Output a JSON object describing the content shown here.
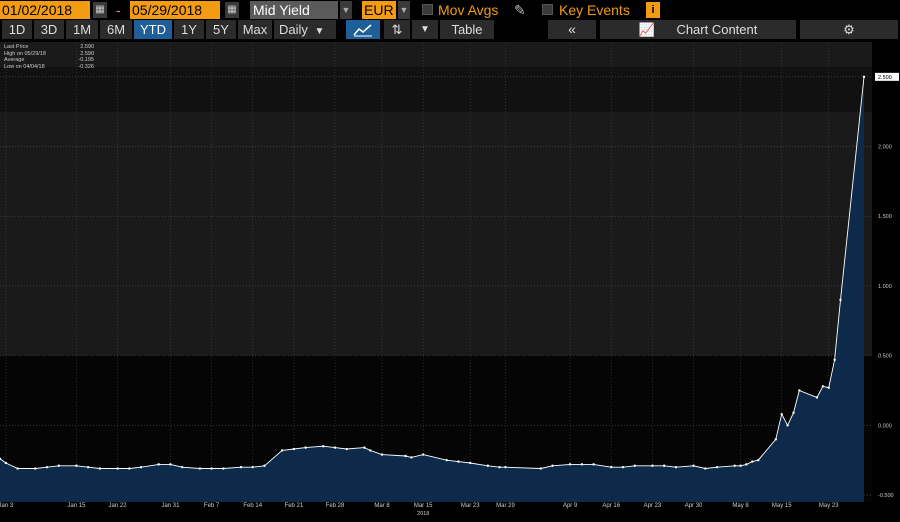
{
  "toolbar": {
    "start_date": "01/02/2018",
    "end_date": "05/29/2018",
    "date_separator": "-",
    "field": "Mid Yield",
    "currency": "EUR",
    "mov_avgs_label": "Mov Avgs",
    "key_events_label": "Key Events",
    "info_glyph": "i",
    "calendar_icon": "calendar-icon",
    "pencil_icon": "pencil-icon"
  },
  "ranges": [
    "1D",
    "3D",
    "1M",
    "6M",
    "YTD",
    "1Y",
    "5Y",
    "Max"
  ],
  "active_range": "YTD",
  "frequency": "Daily",
  "table_label": "Table",
  "chart_content_label": "Chart Content",
  "colors": {
    "accent": "#f39c12",
    "active": "#1f5f99",
    "area": "#0d2a4a",
    "line": "#ffffff"
  },
  "legend": [
    {
      "label": "Last Price",
      "value": "2.590"
    },
    {
      "label": "High on 05/29/18",
      "value": "2.590"
    },
    {
      "label": "Average",
      "value": "-0.195"
    },
    {
      "label": "Low on 04/04/18",
      "value": "-0.326"
    }
  ],
  "chart_data": {
    "type": "area",
    "title": "",
    "xlabel": "",
    "ylabel": "",
    "year_label": "2018",
    "last_value_label": "2.500",
    "ylim": [
      -0.55,
      2.75
    ],
    "y_ticks": [
      2.5,
      2.0,
      1.5,
      1.0,
      0.5,
      0.0,
      -0.5
    ],
    "y_tick_labels": [
      "2.500",
      "2.000",
      "1.500",
      "1.000",
      "0.500",
      "0.000",
      "-0.500"
    ],
    "x_ticks": [
      {
        "label": "Jan 3",
        "date": "2018-01-03"
      },
      {
        "label": "Jan 15",
        "date": "2018-01-15"
      },
      {
        "label": "Jan 22",
        "date": "2018-01-22"
      },
      {
        "label": "Jan 31",
        "date": "2018-01-31"
      },
      {
        "label": "Feb 7",
        "date": "2018-02-07"
      },
      {
        "label": "Feb 14",
        "date": "2018-02-14"
      },
      {
        "label": "Feb 21",
        "date": "2018-02-21"
      },
      {
        "label": "Feb 28",
        "date": "2018-02-28"
      },
      {
        "label": "Mar 8",
        "date": "2018-03-08"
      },
      {
        "label": "Mar 15",
        "date": "2018-03-15"
      },
      {
        "label": "Mar 23",
        "date": "2018-03-23"
      },
      {
        "label": "Mar 29",
        "date": "2018-03-29"
      },
      {
        "label": "Apr 9",
        "date": "2018-04-09"
      },
      {
        "label": "Apr 16",
        "date": "2018-04-16"
      },
      {
        "label": "Apr 23",
        "date": "2018-04-23"
      },
      {
        "label": "Apr 30",
        "date": "2018-04-30"
      },
      {
        "label": "May 8",
        "date": "2018-05-08"
      },
      {
        "label": "May 15",
        "date": "2018-05-15"
      },
      {
        "label": "May 23",
        "date": "2018-05-23"
      }
    ],
    "series": [
      {
        "points": [
          [
            "2018-01-02",
            -0.24
          ],
          [
            "2018-01-03",
            -0.27
          ],
          [
            "2018-01-05",
            -0.31
          ],
          [
            "2018-01-08",
            -0.31
          ],
          [
            "2018-01-10",
            -0.3
          ],
          [
            "2018-01-12",
            -0.29
          ],
          [
            "2018-01-15",
            -0.29
          ],
          [
            "2018-01-17",
            -0.3
          ],
          [
            "2018-01-19",
            -0.31
          ],
          [
            "2018-01-22",
            -0.31
          ],
          [
            "2018-01-24",
            -0.31
          ],
          [
            "2018-01-26",
            -0.3
          ],
          [
            "2018-01-29",
            -0.28
          ],
          [
            "2018-01-31",
            -0.28
          ],
          [
            "2018-02-02",
            -0.3
          ],
          [
            "2018-02-05",
            -0.31
          ],
          [
            "2018-02-07",
            -0.31
          ],
          [
            "2018-02-09",
            -0.31
          ],
          [
            "2018-02-12",
            -0.3
          ],
          [
            "2018-02-14",
            -0.3
          ],
          [
            "2018-02-16",
            -0.29
          ],
          [
            "2018-02-19",
            -0.18
          ],
          [
            "2018-02-21",
            -0.17
          ],
          [
            "2018-02-23",
            -0.16
          ],
          [
            "2018-02-26",
            -0.15
          ],
          [
            "2018-02-28",
            -0.16
          ],
          [
            "2018-03-02",
            -0.17
          ],
          [
            "2018-03-05",
            -0.16
          ],
          [
            "2018-03-06",
            -0.18
          ],
          [
            "2018-03-08",
            -0.21
          ],
          [
            "2018-03-12",
            -0.22
          ],
          [
            "2018-03-13",
            -0.23
          ],
          [
            "2018-03-15",
            -0.21
          ],
          [
            "2018-03-19",
            -0.25
          ],
          [
            "2018-03-21",
            -0.26
          ],
          [
            "2018-03-23",
            -0.27
          ],
          [
            "2018-03-26",
            -0.29
          ],
          [
            "2018-03-28",
            -0.3
          ],
          [
            "2018-03-29",
            -0.3
          ],
          [
            "2018-04-04",
            -0.31
          ],
          [
            "2018-04-06",
            -0.29
          ],
          [
            "2018-04-09",
            -0.28
          ],
          [
            "2018-04-11",
            -0.28
          ],
          [
            "2018-04-13",
            -0.28
          ],
          [
            "2018-04-16",
            -0.3
          ],
          [
            "2018-04-18",
            -0.3
          ],
          [
            "2018-04-20",
            -0.29
          ],
          [
            "2018-04-23",
            -0.29
          ],
          [
            "2018-04-25",
            -0.29
          ],
          [
            "2018-04-27",
            -0.3
          ],
          [
            "2018-04-30",
            -0.29
          ],
          [
            "2018-05-02",
            -0.31
          ],
          [
            "2018-05-04",
            -0.3
          ],
          [
            "2018-05-07",
            -0.29
          ],
          [
            "2018-05-08",
            -0.29
          ],
          [
            "2018-05-09",
            -0.28
          ],
          [
            "2018-05-10",
            -0.26
          ],
          [
            "2018-05-11",
            -0.25
          ],
          [
            "2018-05-14",
            -0.1
          ],
          [
            "2018-05-15",
            0.08
          ],
          [
            "2018-05-16",
            0.0
          ],
          [
            "2018-05-17",
            0.09
          ],
          [
            "2018-05-18",
            0.25
          ],
          [
            "2018-05-21",
            0.2
          ],
          [
            "2018-05-22",
            0.28
          ],
          [
            "2018-05-23",
            0.27
          ],
          [
            "2018-05-24",
            0.47
          ],
          [
            "2018-05-25",
            0.9
          ],
          [
            "2018-05-29",
            2.5
          ]
        ]
      }
    ]
  }
}
